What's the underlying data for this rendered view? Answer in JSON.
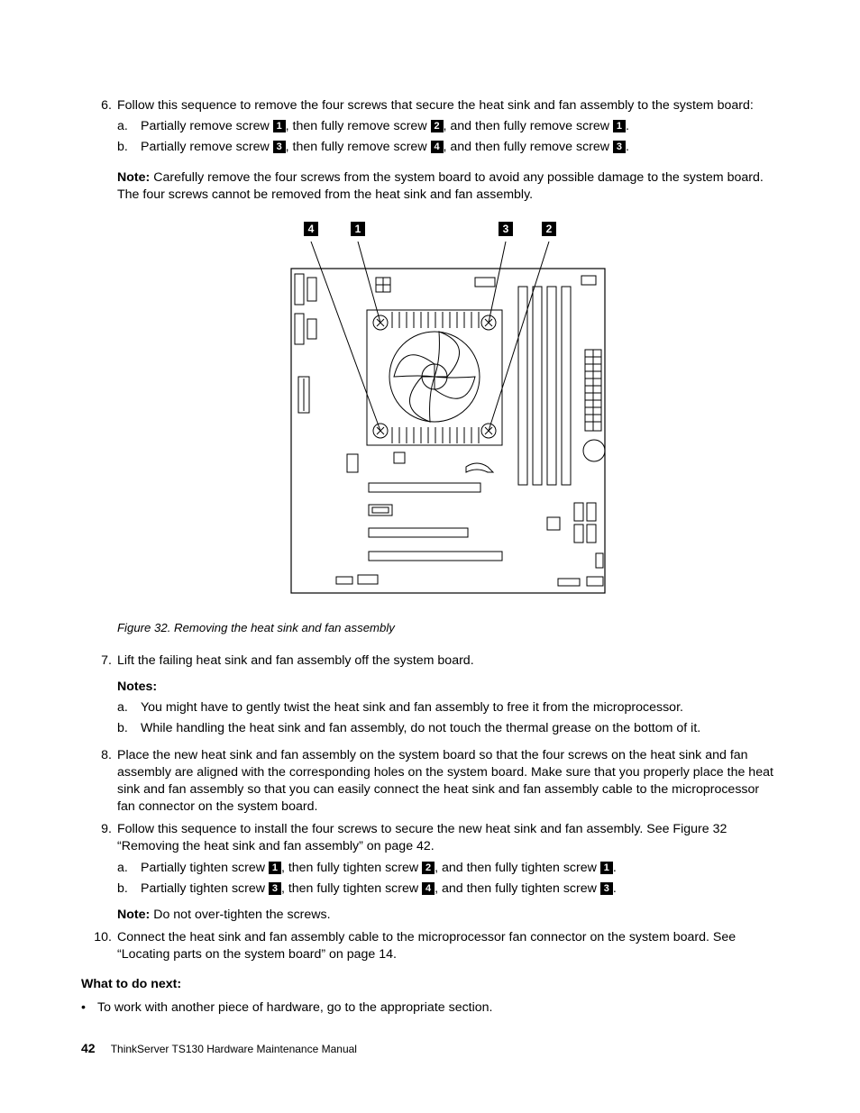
{
  "steps": {
    "six": {
      "num": "6.",
      "text": "Follow this sequence to remove the four screws that secure the heat sink and fan assembly to the system board:",
      "a_num": "a.",
      "a_p1": "Partially remove screw ",
      "a_p2": ", then fully remove screw ",
      "a_p3": ", and then fully remove screw ",
      "a_p4": ".",
      "b_num": "b.",
      "b_p1": "Partially remove screw ",
      "b_p2": ", then fully remove screw ",
      "b_p3": ", and then fully remove screw ",
      "b_p4": "."
    },
    "seven": {
      "num": "7.",
      "text": "Lift the failing heat sink and fan assembly off the system board.",
      "notes_label": "Notes:",
      "a_num": "a.",
      "a_text": "You might have to gently twist the heat sink and fan assembly to free it from the microprocessor.",
      "b_num": "b.",
      "b_text": "While handling the heat sink and fan assembly, do not touch the thermal grease on the bottom of it."
    },
    "eight": {
      "num": "8.",
      "text": "Place the new heat sink and fan assembly on the system board so that the four screws on the heat sink and fan assembly are aligned with the corresponding holes on the system board. Make sure that you properly place the heat sink and fan assembly so that you can easily connect the heat sink and fan assembly cable to the microprocessor fan connector on the system board."
    },
    "nine": {
      "num": "9.",
      "text": "Follow this sequence to install the four screws to secure the new heat sink and fan assembly. See Figure 32 “Removing the heat sink and fan assembly” on page 42.",
      "a_num": "a.",
      "a_p1": "Partially tighten screw ",
      "a_p2": ", then fully tighten screw ",
      "a_p3": ", and then fully tighten screw ",
      "a_p4": ".",
      "b_num": "b.",
      "b_p1": "Partially tighten screw ",
      "b_p2": ", then fully tighten screw ",
      "b_p3": ", and then fully tighten screw ",
      "b_p4": ".",
      "note_label": "Note:",
      "note_text": " Do not over-tighten the screws."
    },
    "ten": {
      "num": "10.",
      "text": "Connect the heat sink and fan assembly cable to the microprocessor fan connector on the system board. See “Locating parts on the system board” on page 14."
    }
  },
  "note1": {
    "label": "Note:",
    "text": " Carefully remove the four screws from the system board to avoid any possible damage to the system board. The four screws cannot be removed from the heat sink and fan assembly."
  },
  "callouts": {
    "c1": "1",
    "c2": "2",
    "c3": "3",
    "c4": "4"
  },
  "figure": {
    "caption": "Figure 32.  Removing the heat sink and fan assembly",
    "label4": "4",
    "label1": "1",
    "label3": "3",
    "label2": "2"
  },
  "next": {
    "heading": "What to do next:",
    "bullet": "To work with another piece of hardware, go to the appropriate section."
  },
  "footer": {
    "page": "42",
    "doc": "ThinkServer TS130 Hardware Maintenance Manual"
  }
}
